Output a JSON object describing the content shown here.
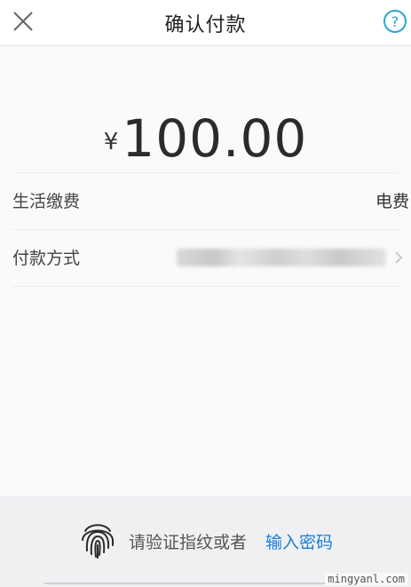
{
  "header": {
    "title": "确认付款"
  },
  "payment": {
    "currency": "¥",
    "amount": "100.00",
    "rows": [
      {
        "label": "生活缴费",
        "value": "电费"
      },
      {
        "label": "付款方式"
      }
    ]
  },
  "auth": {
    "prompt": "请验证指纹或者",
    "link": "输入密码"
  },
  "watermark": "mingyanl.com",
  "colors": {
    "accent": "#1a7fd6",
    "help_icon": "#2aa7c8"
  },
  "icons": [
    "close-icon",
    "help-icon",
    "fingerprint-icon",
    "chevron-right-icon"
  ]
}
